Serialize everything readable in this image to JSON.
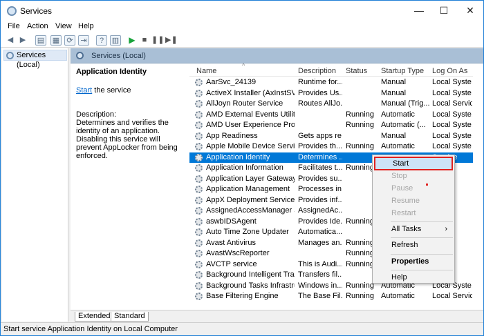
{
  "window": {
    "title": "Services",
    "minimize_glyph": "—",
    "maximize_glyph": "☐",
    "close_glyph": "✕"
  },
  "menu": [
    "File",
    "Action",
    "View",
    "Help"
  ],
  "toolbar": {
    "icons": [
      "back-arrow-icon",
      "forward-arrow-icon",
      "console-tree-icon",
      "properties-icon",
      "refresh-icon",
      "export-icon",
      "help-icon",
      "view-icon",
      "start-service-icon",
      "stop-service-icon",
      "pause-service-icon",
      "restart-service-icon"
    ]
  },
  "tree": {
    "root_label": "Services (Local)"
  },
  "pane": {
    "header_title": "Services (Local)",
    "description_panel": {
      "service_name": "Application Identity",
      "start_link": "Start",
      "start_suffix": " the service",
      "description_label": "Description:",
      "description_text": "Determines and verifies the identity of an application. Disabling this service will prevent AppLocker from being enforced."
    }
  },
  "list": {
    "sort_glyph": "^",
    "columns": [
      "Name",
      "Description",
      "Status",
      "Startup Type",
      "Log On As"
    ],
    "rows": [
      {
        "name": "AarSvc_24139",
        "description": "Runtime for...",
        "status": "",
        "startup": "Manual",
        "logon": "Local Syste..."
      },
      {
        "name": "ActiveX Installer (AxInstSV)",
        "description": "Provides Us...",
        "status": "",
        "startup": "Manual",
        "logon": "Local Syste..."
      },
      {
        "name": "AllJoyn Router Service",
        "description": "Routes AllJo...",
        "status": "",
        "startup": "Manual (Trig...",
        "logon": "Local Service"
      },
      {
        "name": "AMD External Events Utility",
        "description": "",
        "status": "Running",
        "startup": "Automatic",
        "logon": "Local Syste..."
      },
      {
        "name": "AMD User Experience Progr...",
        "description": "",
        "status": "Running",
        "startup": "Automatic (...",
        "logon": "Local Syste..."
      },
      {
        "name": "App Readiness",
        "description": "Gets apps re...",
        "status": "",
        "startup": "Manual",
        "logon": "Local Syste..."
      },
      {
        "name": "Apple Mobile Device Service",
        "description": "Provides th...",
        "status": "Running",
        "startup": "Automatic",
        "logon": "Local Syste..."
      },
      {
        "name": "Application Identity",
        "description": "Determines ...",
        "status": "",
        "startup": "",
        "logon": "Service",
        "selected": true
      },
      {
        "name": "Application Information",
        "description": "Facilitates t...",
        "status": "Running",
        "startup": "",
        "logon": "ste..."
      },
      {
        "name": "Application Layer Gateway ...",
        "description": "Provides su...",
        "status": "",
        "startup": "",
        "logon": "vice"
      },
      {
        "name": "Application Management",
        "description": "Processes in...",
        "status": "",
        "startup": "",
        "logon": "ste..."
      },
      {
        "name": "AppX Deployment Service (...",
        "description": "Provides inf...",
        "status": "",
        "startup": "",
        "logon": "ste..."
      },
      {
        "name": "AssignedAccessManager Se...",
        "description": "AssignedAc...",
        "status": "",
        "startup": "",
        "logon": "ste..."
      },
      {
        "name": "aswbIDSAgent",
        "description": "Provides Ide...",
        "status": "Running",
        "startup": "",
        "logon": "ste..."
      },
      {
        "name": "Auto Time Zone Updater",
        "description": "Automatica...",
        "status": "",
        "startup": "",
        "logon": "vice"
      },
      {
        "name": "Avast Antivirus",
        "description": "Manages an...",
        "status": "Running",
        "startup": "",
        "logon": "ste..."
      },
      {
        "name": "AvastWscReporter",
        "description": "",
        "status": "Running",
        "startup": "",
        "logon": "ste..."
      },
      {
        "name": "AVCTP service",
        "description": "This is Audi...",
        "status": "Running",
        "startup": "",
        "logon": "vice"
      },
      {
        "name": "Background Intelligent Tran...",
        "description": "Transfers fil...",
        "status": "",
        "startup": "",
        "logon": "ste..."
      },
      {
        "name": "Background Tasks Infrastruc...",
        "description": "Windows in...",
        "status": "Running",
        "startup": "Automatic",
        "logon": "Local Syste..."
      },
      {
        "name": "Base Filtering Engine",
        "description": "The Base Fil...",
        "status": "Running",
        "startup": "Automatic",
        "logon": "Local Service"
      }
    ]
  },
  "context_menu": {
    "items": [
      "Start",
      "Stop",
      "Pause",
      "Resume",
      "Restart",
      "All Tasks",
      "Refresh",
      "Properties",
      "Help"
    ],
    "submenu_glyph": "›"
  },
  "tabs": [
    "Extended",
    "Standard"
  ],
  "statusbar": {
    "text": "Start service Application Identity on Local Computer"
  },
  "colors": {
    "selection": "#0078d7",
    "highlight_border": "#e0201e",
    "window_border": "#1f7fd6",
    "pane_header": "#a9bfd6"
  }
}
